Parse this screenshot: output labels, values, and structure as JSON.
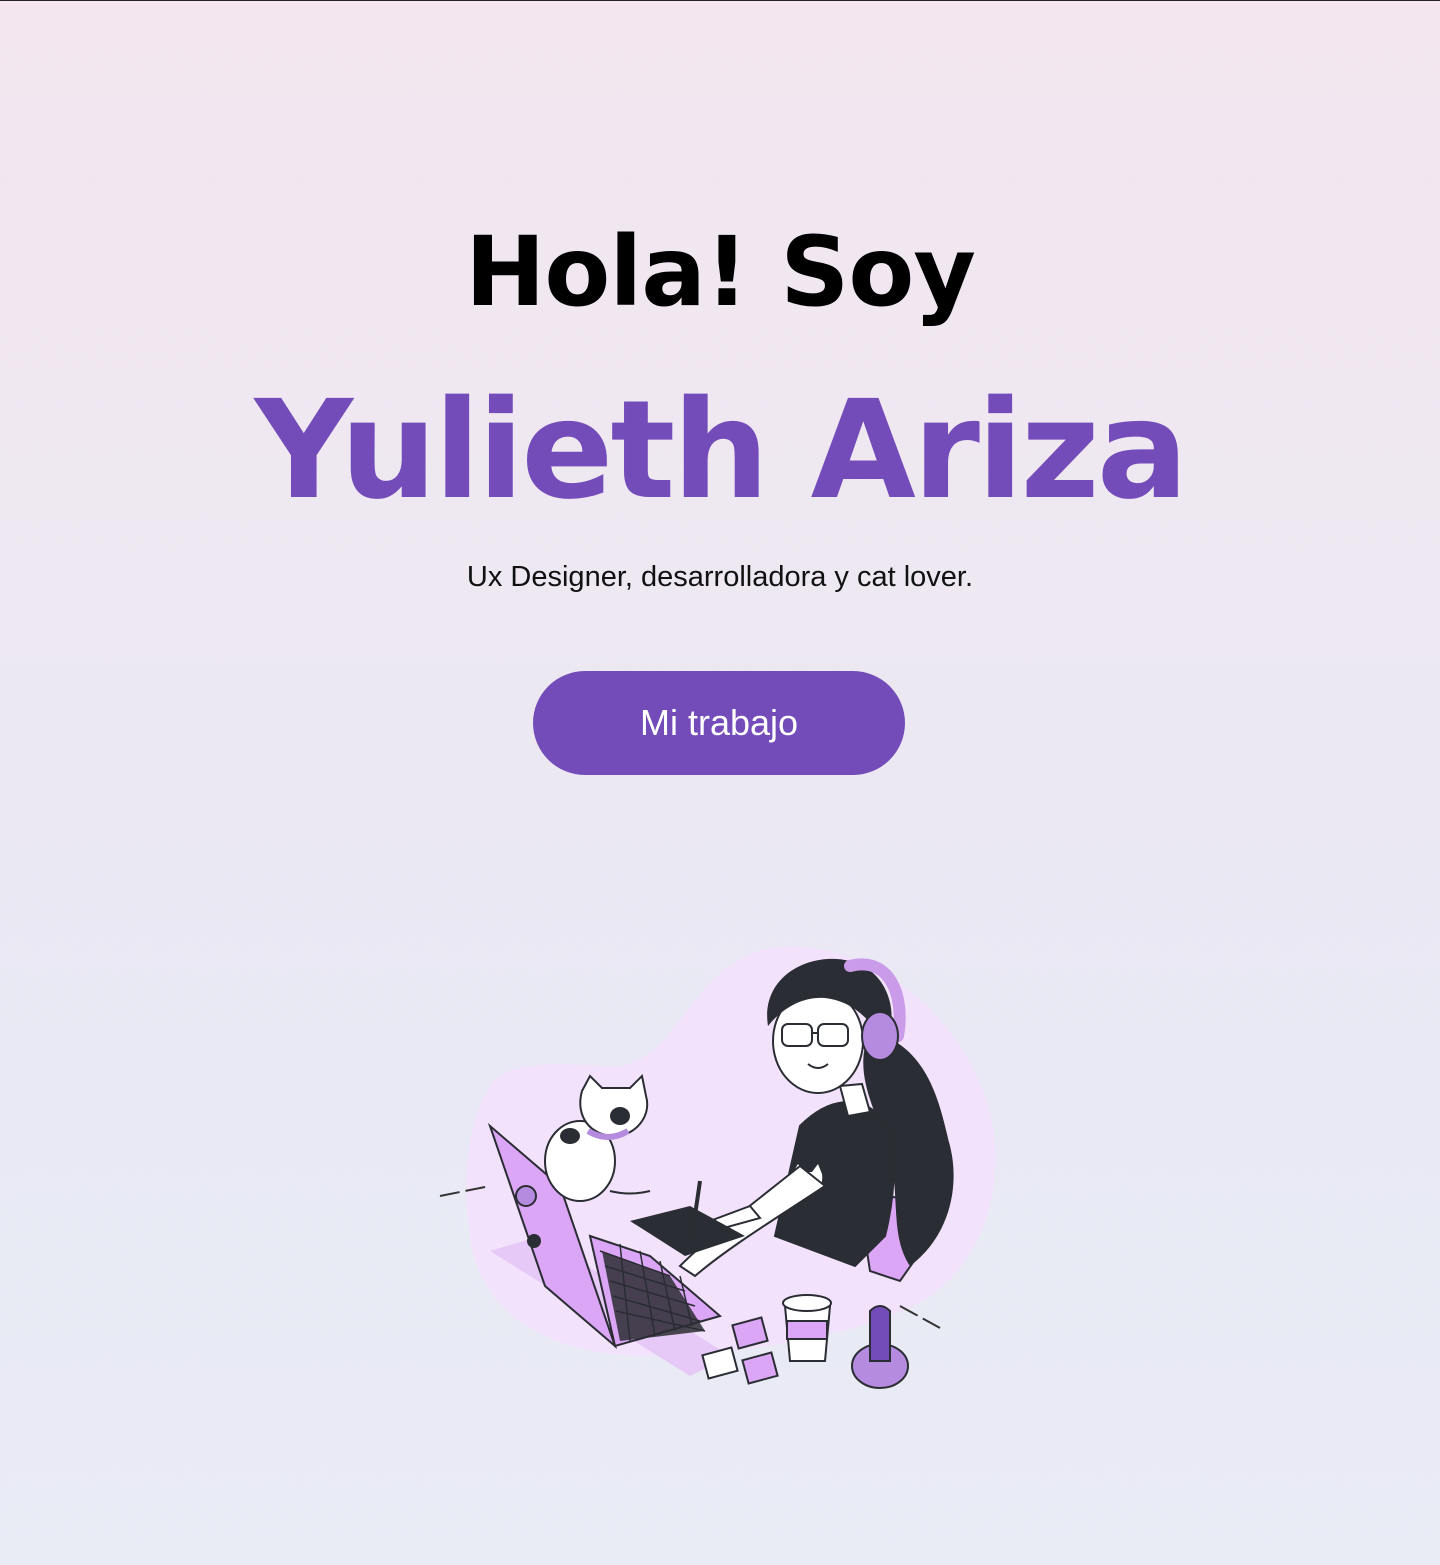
{
  "hero": {
    "greeting": "Hola! Soy",
    "name": "Yulieth Ariza",
    "tagline": "Ux Designer, desarrolladora y cat lover.",
    "cta_label": "Mi trabajo"
  },
  "illustration": {
    "icon": "designer-with-cat-illustration"
  },
  "colors": {
    "accent": "#734cb9",
    "lilac": "#dca6f6",
    "dark": "#2a2d33",
    "blob": "#f3e2fb"
  }
}
